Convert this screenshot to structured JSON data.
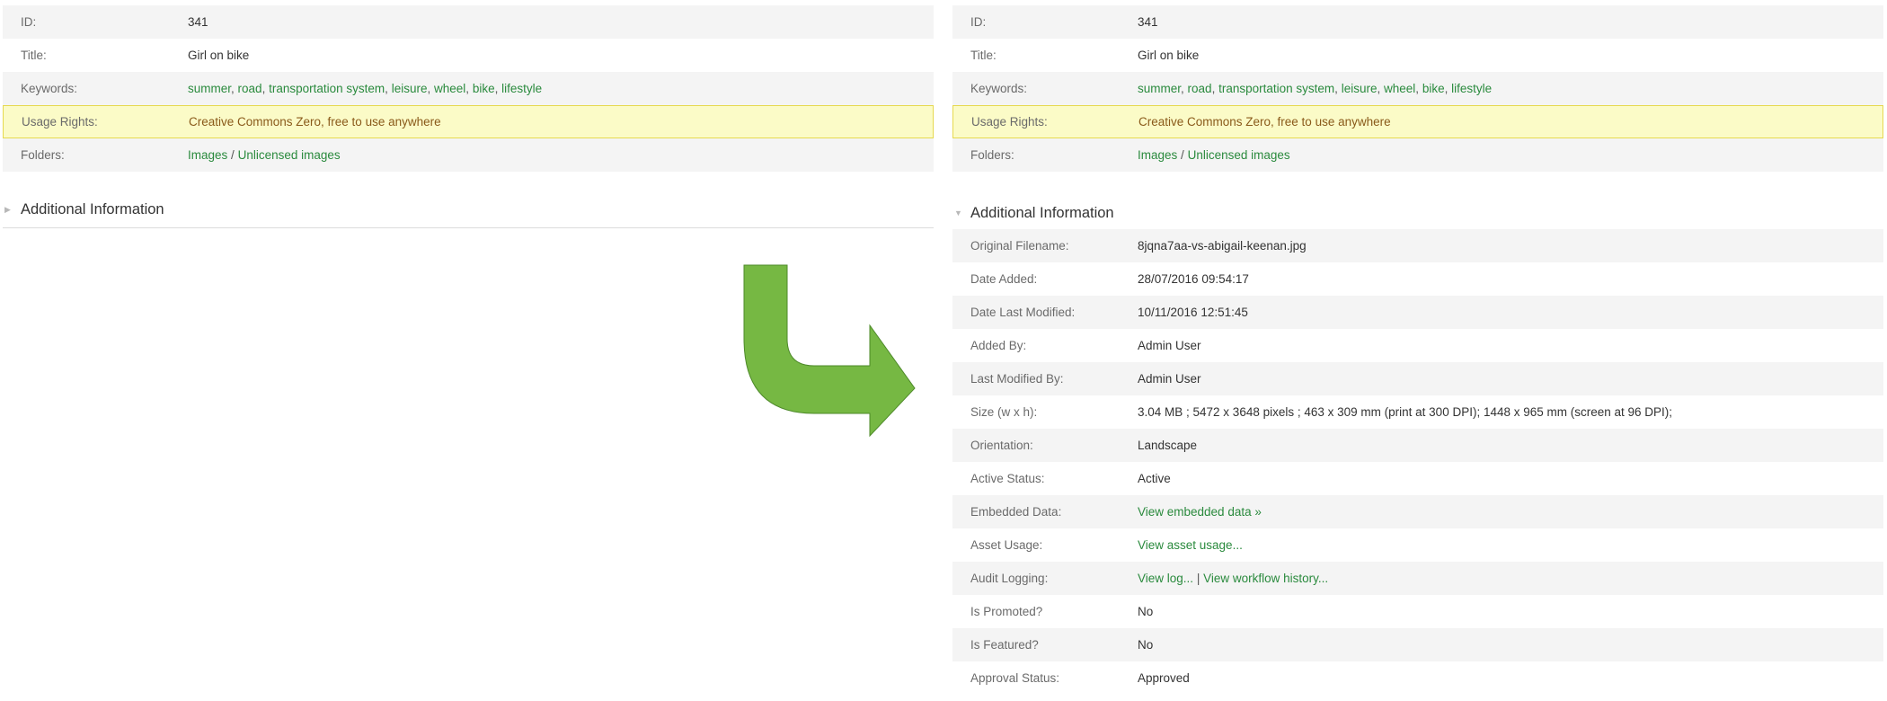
{
  "fields": {
    "id": {
      "label": "ID:",
      "value": "341"
    },
    "title": {
      "label": "Title:",
      "value": "Girl on bike"
    },
    "keywords": {
      "label": "Keywords:",
      "items": [
        "summer",
        "road",
        "transportation system",
        "leisure",
        "wheel",
        "bike",
        "lifestyle"
      ]
    },
    "usage_rights": {
      "label": "Usage Rights:",
      "value": "Creative Commons Zero, free to use anywhere"
    },
    "folders": {
      "label": "Folders:",
      "path": [
        "Images",
        "Unlicensed images"
      ],
      "separator": "/"
    }
  },
  "keyword_separator": ",",
  "additional_info": {
    "heading": "Additional Information",
    "left_state": "collapsed",
    "right_state": "expanded",
    "original_filename": {
      "label": "Original Filename:",
      "value": "8jqna7aa-vs-abigail-keenan.jpg"
    },
    "date_added": {
      "label": "Date Added:",
      "value": "28/07/2016 09:54:17"
    },
    "date_last_modified": {
      "label": "Date Last Modified:",
      "value": "10/11/2016 12:51:45"
    },
    "added_by": {
      "label": "Added By:",
      "value": "Admin User"
    },
    "last_modified_by": {
      "label": "Last Modified By:",
      "value": "Admin User"
    },
    "size": {
      "label": "Size (w x h):",
      "value": "3.04 MB ; 5472 x 3648 pixels ; 463 x 309 mm (print at 300 DPI); 1448 x 965 mm (screen at 96 DPI);"
    },
    "orientation": {
      "label": "Orientation:",
      "value": "Landscape"
    },
    "active_status": {
      "label": "Active Status:",
      "value": "Active"
    },
    "embedded_data": {
      "label": "Embedded Data:",
      "link": "View embedded data »"
    },
    "asset_usage": {
      "label": "Asset Usage:",
      "link": "View asset usage..."
    },
    "audit_logging": {
      "label": "Audit Logging:",
      "link1": "View log...",
      "separator": "|",
      "link2": "View workflow history..."
    },
    "is_promoted": {
      "label": "Is Promoted?",
      "value": "No"
    },
    "is_featured": {
      "label": "Is Featured?",
      "value": "No"
    },
    "approval_status": {
      "label": "Approval Status:",
      "value": "Approved"
    }
  },
  "colors": {
    "link": "#2a8a3d",
    "usage_highlight_bg": "#fbfbc7",
    "usage_highlight_border": "#e6d950",
    "row_shade": "#f4f4f4",
    "arrow_fill": "#76b843",
    "arrow_stroke": "#4e8a2a"
  }
}
